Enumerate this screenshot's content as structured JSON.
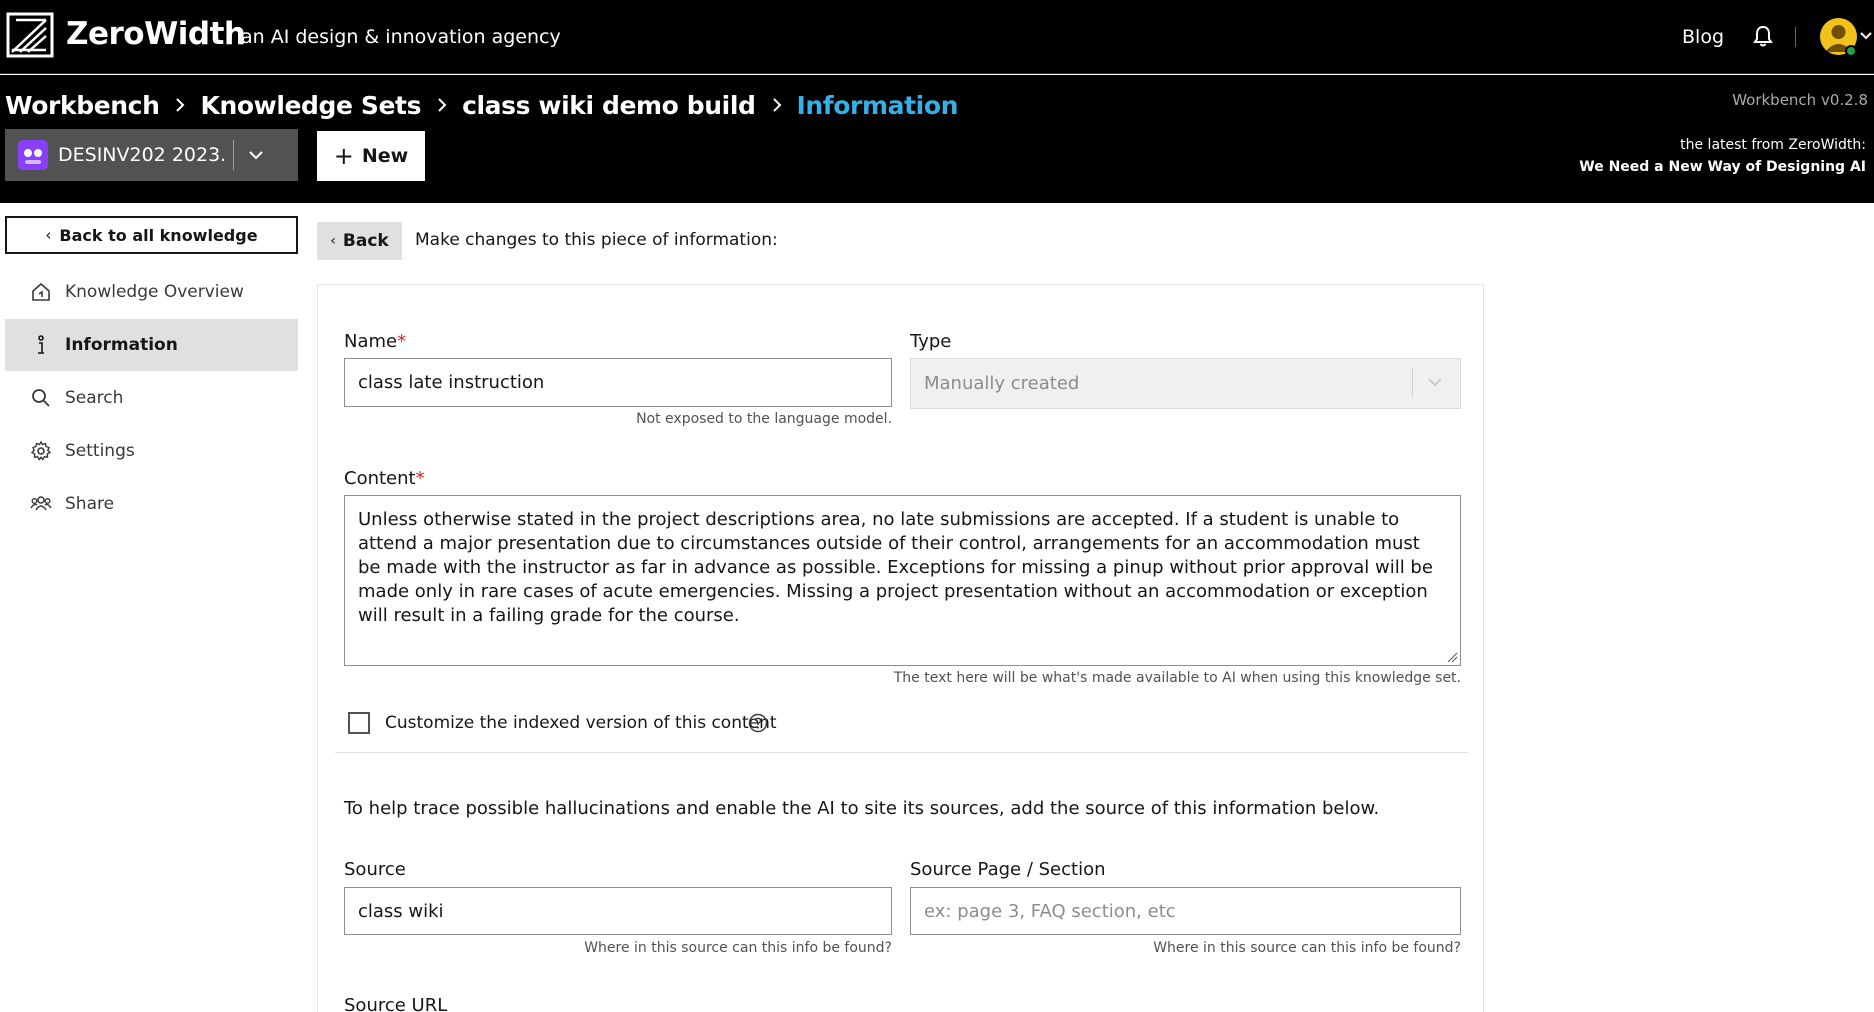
{
  "topbar": {
    "brand": "ZeroWidth",
    "tagline": "an AI design & innovation agency",
    "blog": "Blog"
  },
  "breadcrumb": {
    "items": [
      "Workbench",
      "Knowledge Sets",
      "class wiki demo build"
    ],
    "current": "Information"
  },
  "header": {
    "version": "Workbench v0.2.8",
    "project": "DESINV202 2023...",
    "new_label": "New",
    "latest_label": "the latest from ZeroWidth:",
    "latest_title": "We Need a New Way of Designing AI"
  },
  "sidebar": {
    "back_label": "Back to all knowledge",
    "items": [
      {
        "label": "Knowledge Overview",
        "icon": "home-icon"
      },
      {
        "label": "Information",
        "icon": "info-icon",
        "active": true
      },
      {
        "label": "Search",
        "icon": "search-icon"
      },
      {
        "label": "Settings",
        "icon": "gear-icon"
      },
      {
        "label": "Share",
        "icon": "people-icon"
      }
    ]
  },
  "main": {
    "back_label": "Back",
    "intro": "Make changes to this piece of information:",
    "name_label": "Name",
    "name_value": "class late instruction",
    "name_helper": "Not exposed to the language model.",
    "type_label": "Type",
    "type_value": "Manually created",
    "content_label": "Content",
    "content_value": "Unless otherwise stated in the project descriptions area, no late submissions are accepted. If a student is unable to attend a major presentation due to circumstances outside of their control, arrangements for an accommodation must be made with the instructor as far in advance as possible. Exceptions for missing a pinup without prior approval will be made only in rare cases of acute emergencies. Missing a project presentation without an accommodation or exception will result in a failing grade for the course.",
    "content_helper": "The text here will be what's made available to AI when using this knowledge set.",
    "customize_label": "Customize the indexed version of this content",
    "trace_text": "To help trace possible hallucinations and enable the AI to site its sources, add the source of this information below.",
    "source_label": "Source",
    "source_value": "class wiki",
    "source_helper": "Where in this source can this info be found?",
    "source_page_label": "Source Page / Section",
    "source_page_placeholder": "ex: page 3, FAQ section, etc",
    "source_page_helper": "Where in this source can this info be found?",
    "source_url_label": "Source URL"
  },
  "colors": {
    "accent": "#33b1e7",
    "required": "#da1e28",
    "header_bg": "#000000",
    "project_avatar": "#8a3ffc",
    "user_avatar": "#f1c21b",
    "online": "#24a148"
  }
}
